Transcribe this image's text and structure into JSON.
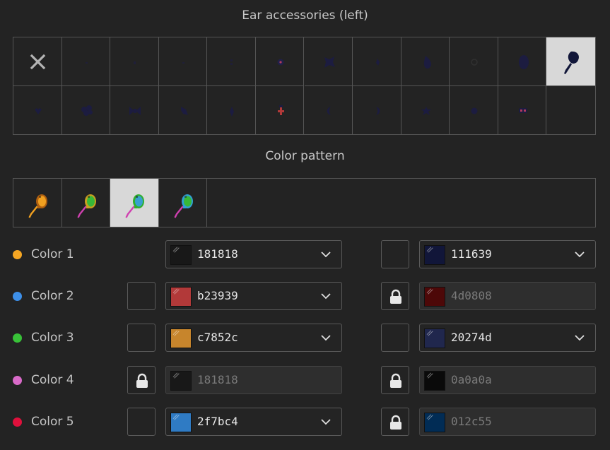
{
  "headings": {
    "ear_accessories": "Ear accessories (left)",
    "color_pattern": "Color pattern"
  },
  "ear_accessories": {
    "selected_index": 11,
    "items": [
      {
        "icon": "none-x-icon",
        "color": "#b4b4b4"
      },
      {
        "icon": "tiny-dot-icon",
        "color": "#1f1f38"
      },
      {
        "icon": "small-dot-icon",
        "color": "#1f1f38"
      },
      {
        "icon": "tiny-dot-icon",
        "color": "#1f1f38"
      },
      {
        "icon": "double-dot-icon",
        "color": "#1f1f38"
      },
      {
        "icon": "ring-stud-icon",
        "color": "#202048"
      },
      {
        "icon": "flower-icon",
        "color": "#1c1c40"
      },
      {
        "icon": "drop-icon",
        "color": "#1c1c40"
      },
      {
        "icon": "teardrop-icon",
        "color": "#1c1c40"
      },
      {
        "icon": "hoop-icon",
        "color": "#303030"
      },
      {
        "icon": "oval-icon",
        "color": "#1c1c40"
      },
      {
        "icon": "magnifier-pendant-icon",
        "color": "#111639"
      },
      {
        "icon": "heart-icon",
        "color": "#1c1c40"
      },
      {
        "icon": "cluster-icon",
        "color": "#1c1c40"
      },
      {
        "icon": "bow-icon",
        "color": "#1c1c40"
      },
      {
        "icon": "leaf-icon",
        "color": "#1c1c40"
      },
      {
        "icon": "spike-icon",
        "color": "#1c1c40"
      },
      {
        "icon": "cross-icon",
        "color": "#b23939"
      },
      {
        "icon": "crescent-left-icon",
        "color": "#1c1c40"
      },
      {
        "icon": "crescent-right-icon",
        "color": "#1c1c40"
      },
      {
        "icon": "star-icon",
        "color": "#1c1c40"
      },
      {
        "icon": "round-stud-icon",
        "color": "#1c1c40"
      },
      {
        "icon": "twin-gem-icon",
        "color": "#1c1c40"
      },
      {
        "icon": "empty-slot",
        "color": ""
      }
    ]
  },
  "color_pattern": {
    "selected_index": 2,
    "items": [
      {
        "icon": "pendant-pattern-1-icon",
        "head": "#f0a020",
        "rim": "#b06010",
        "handle": "#f0a020"
      },
      {
        "icon": "pendant-pattern-2-icon",
        "head": "#38b838",
        "rim": "#c8a020",
        "handle": "#d040b0"
      },
      {
        "icon": "pendant-pattern-3-icon",
        "head": "#38a0d0",
        "rim": "#30b030",
        "handle": "#d040b0"
      },
      {
        "icon": "pendant-pattern-4-icon",
        "head": "#38b838",
        "rim": "#30a0d0",
        "handle": "#d040b0"
      }
    ]
  },
  "colors": [
    {
      "label": "Color 1",
      "dot": "#f5a623",
      "primary": {
        "hex": "181818",
        "swatch": "#181818",
        "locked": false,
        "dropdown": true,
        "toggle": "none"
      },
      "secondary": {
        "hex": "111639",
        "swatch": "#111639",
        "locked": false,
        "dropdown": true,
        "toggle": "empty"
      }
    },
    {
      "label": "Color 2",
      "dot": "#3d8fe8",
      "primary": {
        "hex": "b23939",
        "swatch": "#b23939",
        "locked": false,
        "dropdown": true,
        "toggle": "empty"
      },
      "secondary": {
        "hex": "4d0808",
        "swatch": "#4d0808",
        "locked": true,
        "dropdown": false,
        "toggle": "lock"
      }
    },
    {
      "label": "Color 3",
      "dot": "#38c138",
      "primary": {
        "hex": "c7852c",
        "swatch": "#c7852c",
        "locked": false,
        "dropdown": true,
        "toggle": "empty"
      },
      "secondary": {
        "hex": "20274d",
        "swatch": "#20274d",
        "locked": false,
        "dropdown": true,
        "toggle": "empty"
      }
    },
    {
      "label": "Color 4",
      "dot": "#d86ac8",
      "primary": {
        "hex": "181818",
        "swatch": "#181818",
        "locked": true,
        "dropdown": false,
        "toggle": "lock"
      },
      "secondary": {
        "hex": "0a0a0a",
        "swatch": "#0a0a0a",
        "locked": true,
        "dropdown": false,
        "toggle": "lock"
      }
    },
    {
      "label": "Color 5",
      "dot": "#e0103c",
      "primary": {
        "hex": "2f7bc4",
        "swatch": "#2f7bc4",
        "locked": false,
        "dropdown": true,
        "toggle": "empty"
      },
      "secondary": {
        "hex": "012c55",
        "swatch": "#012c55",
        "locked": true,
        "dropdown": false,
        "toggle": "lock"
      }
    }
  ]
}
